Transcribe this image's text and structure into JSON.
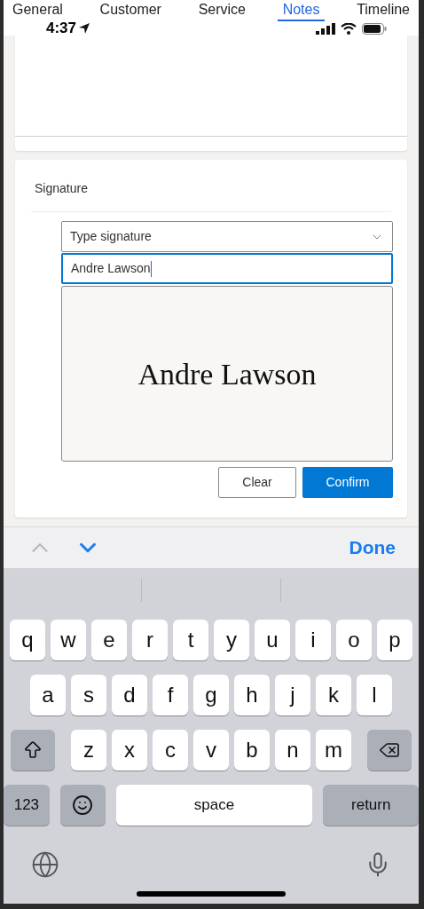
{
  "tabs": [
    {
      "label": "General",
      "selected": false
    },
    {
      "label": "Customer",
      "selected": false
    },
    {
      "label": "Service",
      "selected": false
    },
    {
      "label": "Notes",
      "selected": true
    },
    {
      "label": "Timeline",
      "selected": false
    }
  ],
  "status_bar": {
    "time": "4:37"
  },
  "signature": {
    "title": "Signature",
    "type_select": {
      "value": "Type signature"
    },
    "name_field": {
      "value": "Andre Lawson",
      "focused": true
    },
    "preview": "Andre Lawson",
    "buttons": [
      {
        "label": "Clear",
        "kind": "secondary"
      },
      {
        "label": "Confirm",
        "kind": "primary"
      }
    ]
  },
  "accessory_bar": {
    "previous_disabled": true,
    "done": "Done"
  },
  "keyboard": {
    "rows": [
      {
        "keys": [
          {
            "label": "q",
            "kind": "letter"
          },
          {
            "label": "w",
            "kind": "letter"
          },
          {
            "label": "e",
            "kind": "letter"
          },
          {
            "label": "r",
            "kind": "letter"
          },
          {
            "label": "t",
            "kind": "letter"
          },
          {
            "label": "y",
            "kind": "letter"
          },
          {
            "label": "u",
            "kind": "letter"
          },
          {
            "label": "i",
            "kind": "letter"
          },
          {
            "label": "o",
            "kind": "letter"
          },
          {
            "label": "p",
            "kind": "letter"
          }
        ]
      },
      {
        "keys": [
          {
            "label": "a",
            "kind": "letter"
          },
          {
            "label": "s",
            "kind": "letter"
          },
          {
            "label": "d",
            "kind": "letter"
          },
          {
            "label": "f",
            "kind": "letter"
          },
          {
            "label": "g",
            "kind": "letter"
          },
          {
            "label": "h",
            "kind": "letter"
          },
          {
            "label": "j",
            "kind": "letter"
          },
          {
            "label": "k",
            "kind": "letter"
          },
          {
            "label": "l",
            "kind": "letter"
          }
        ]
      },
      {
        "keys": [
          {
            "kind": "shift"
          },
          {
            "label": "z",
            "kind": "letter"
          },
          {
            "label": "x",
            "kind": "letter"
          },
          {
            "label": "c",
            "kind": "letter"
          },
          {
            "label": "v",
            "kind": "letter"
          },
          {
            "label": "b",
            "kind": "letter"
          },
          {
            "label": "n",
            "kind": "letter"
          },
          {
            "label": "m",
            "kind": "letter"
          },
          {
            "kind": "delete"
          }
        ]
      },
      {
        "keys": [
          {
            "label": "123",
            "kind": "mode"
          },
          {
            "kind": "emoji"
          },
          {
            "label": "space",
            "kind": "space"
          },
          {
            "label": "return",
            "kind": "return"
          }
        ]
      }
    ]
  }
}
